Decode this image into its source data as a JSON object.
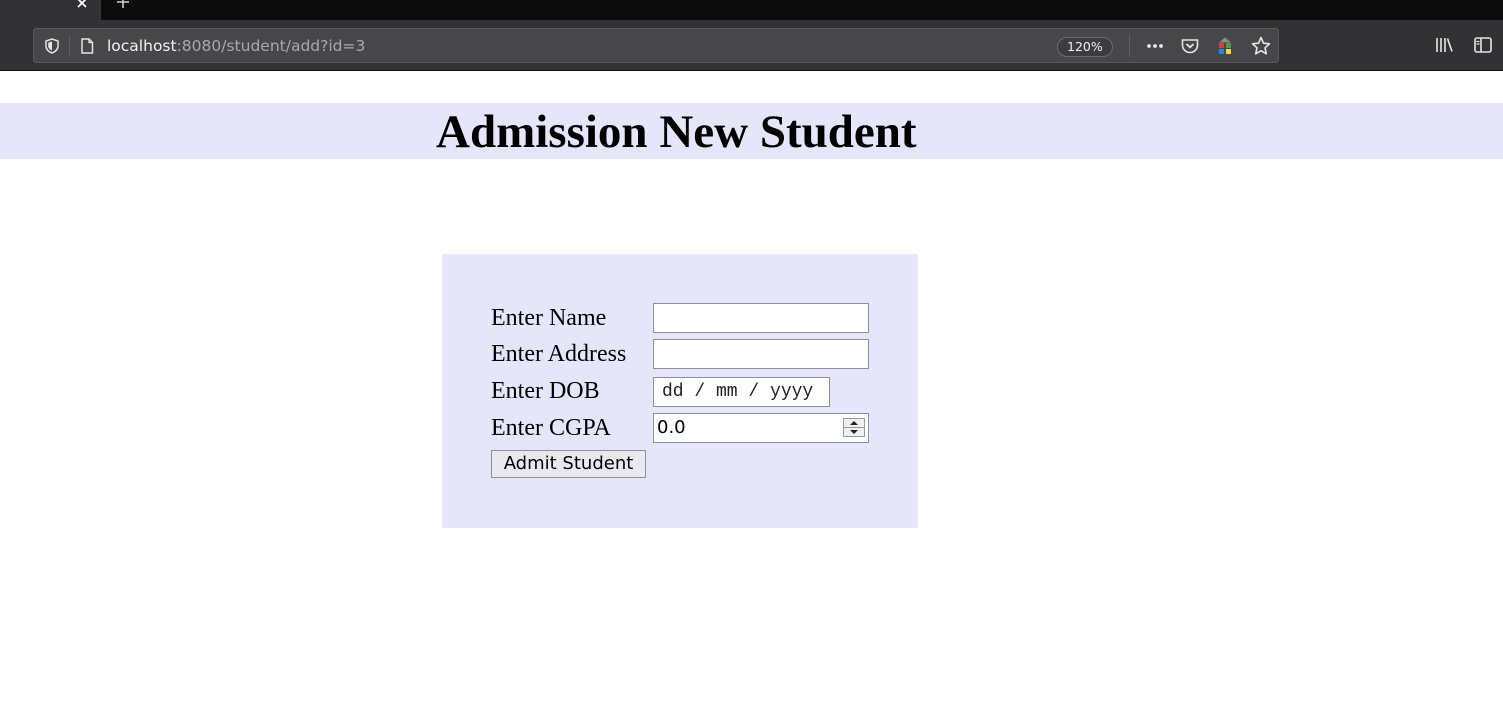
{
  "browser": {
    "url_host": "localhost",
    "url_rest": ":8080/student/add?id=3",
    "zoom": "120%",
    "icons": [
      "close-icon",
      "new-tab-icon",
      "shield-icon",
      "page-icon",
      "more-actions-icon",
      "pocket-icon",
      "extension-icon",
      "bookmark-star-icon",
      "library-icon",
      "sidebar-icon"
    ]
  },
  "page": {
    "title": "Admission New Student",
    "background_color": "#e6e6fa"
  },
  "form": {
    "name_label": "Enter Name",
    "name_value": "",
    "address_label": "Enter Address",
    "address_value": "",
    "dob_label": "Enter DOB",
    "dob_placeholder": "dd / mm / yyyy",
    "cgpa_label": "Enter CGPA",
    "cgpa_value": "0.0",
    "submit_label": "Admit Student"
  }
}
